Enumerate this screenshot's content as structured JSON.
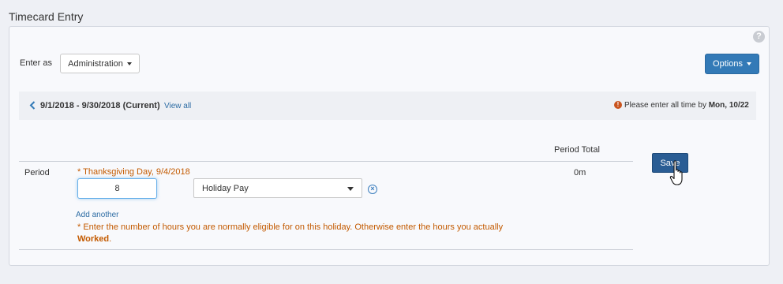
{
  "page": {
    "title": "Timecard Entry"
  },
  "help": {
    "icon": "question-icon",
    "glyph": "?"
  },
  "enter_as": {
    "label": "Enter as",
    "value": "Administration"
  },
  "options_button": {
    "label": "Options"
  },
  "period_nav": {
    "range": "9/1/2018 - 9/30/2018 (Current)",
    "view_all": "View all",
    "alert_glyph": "!",
    "alert_text": "Please enter all time by ",
    "alert_date": "Mon, 10/22"
  },
  "table": {
    "header_total": "Period Total",
    "row_label": "Period",
    "holiday": "* Thanksgiving Day, 9/4/2018",
    "row_total": "0m",
    "hours_value": "8",
    "pay_type": "Holiday Pay",
    "add_another": "Add another",
    "note_text": "* Enter the number of hours you are normally eligible for on this holiday. Otherwise enter the hours you actually ",
    "note_strong": "Worked",
    "note_end": "."
  },
  "save_button": {
    "label": "Save"
  },
  "colors": {
    "primary": "#337ab7",
    "save": "#2a5d94",
    "warning": "#c35a00",
    "link": "#2e6da4"
  }
}
